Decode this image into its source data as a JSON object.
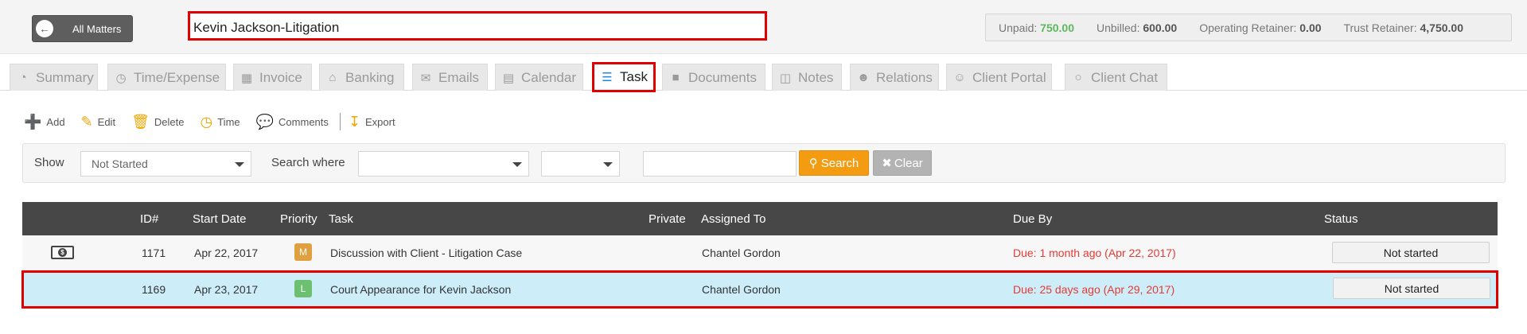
{
  "header": {
    "all_matters_label": "All Matters",
    "matter_title": "Kevin Jackson-Litigation",
    "financials": [
      {
        "label": "Unpaid:",
        "value": "750.00",
        "color": "#5cb85c"
      },
      {
        "label": "Unbilled:",
        "value": "600.00"
      },
      {
        "label": "Operating Retainer:",
        "value": "0.00"
      },
      {
        "label": "Trust Retainer:",
        "value": "4,750.00"
      }
    ]
  },
  "tabs": [
    {
      "label": "Summary",
      "icon": "dashboard-icon"
    },
    {
      "label": "Time/Expense",
      "icon": "clock-icon"
    },
    {
      "label": "Invoice",
      "icon": "table-icon"
    },
    {
      "label": "Banking",
      "icon": "bank-icon"
    },
    {
      "label": "Emails",
      "icon": "envelope-icon"
    },
    {
      "label": "Calendar",
      "icon": "calendar-icon"
    },
    {
      "label": "Task",
      "icon": "task-list-icon",
      "active": true
    },
    {
      "label": "Documents",
      "icon": "folder-icon"
    },
    {
      "label": "Notes",
      "icon": "file-icon"
    },
    {
      "label": "Relations",
      "icon": "users-icon"
    },
    {
      "label": "Client Portal",
      "icon": "client-portal-icon"
    },
    {
      "label": "Client Chat",
      "icon": "chat-icon"
    }
  ],
  "toolbar": {
    "add": "Add",
    "edit": "Edit",
    "delete": "Delete",
    "time": "Time",
    "comments": "Comments",
    "export": "Export"
  },
  "filter": {
    "show_label": "Show",
    "show_value": "Not Started",
    "search_where_label": "Search where",
    "search_where_value": "",
    "operator_value": "",
    "search_text": "",
    "search_button": "Search",
    "clear_button": "Clear"
  },
  "table": {
    "columns": [
      "ID#",
      "Start Date",
      "Priority",
      "Task",
      "Private",
      "Assigned To",
      "Due By",
      "Status"
    ],
    "rows": [
      {
        "has_billing_icon": true,
        "id": "1171",
        "start_date": "Apr 22, 2017",
        "priority": "M",
        "priority_color": "#e0a040",
        "task": "Discussion with Client - Litigation Case",
        "private": "",
        "assigned_to": "Chantel Gordon",
        "due_by": "Due: 1 month ago (Apr 22, 2017)",
        "status": "Not started"
      },
      {
        "has_billing_icon": false,
        "id": "1169",
        "start_date": "Apr 23, 2017",
        "priority": "L",
        "priority_color": "#6cc070",
        "task": "Court Appearance for Kevin Jackson",
        "private": "",
        "assigned_to": "Chantel Gordon",
        "due_by": "Due: 25 days ago (Apr 29, 2017)",
        "status": "Not started"
      }
    ]
  }
}
